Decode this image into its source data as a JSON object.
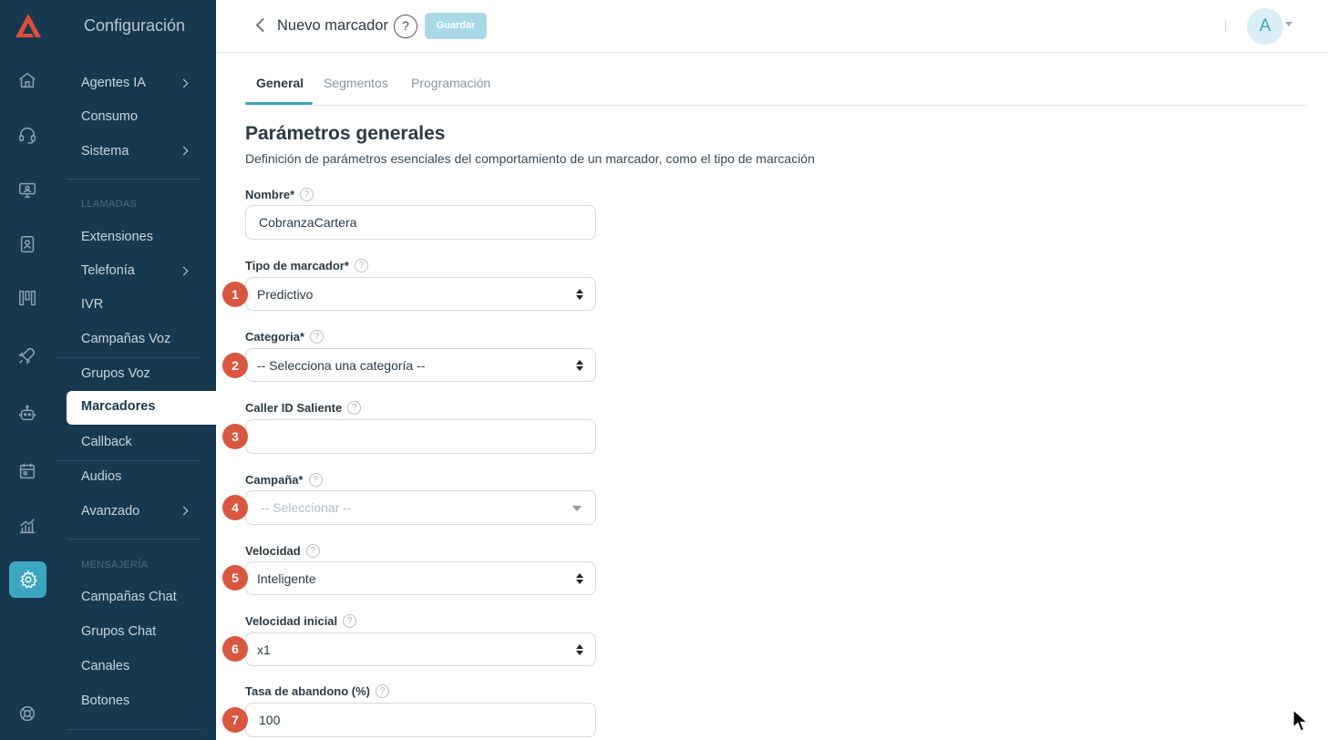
{
  "menu": {
    "title": "Configuración",
    "items": [
      {
        "label": "Agentes IA",
        "has_chevron": true
      },
      {
        "label": "Consumo"
      },
      {
        "label": "Sistema",
        "has_chevron": true
      }
    ],
    "section_calls": "LLAMADAS",
    "call_items": [
      {
        "label": "Extensiones"
      },
      {
        "label": "Telefonía",
        "has_chevron": true
      },
      {
        "label": "IVR"
      },
      {
        "label": "Campañas Voz"
      },
      {
        "label": "Grupos Voz"
      },
      {
        "label": "Marcadores",
        "active": true
      },
      {
        "label": "Callback"
      },
      {
        "label": "Audios"
      },
      {
        "label": "Avanzado",
        "has_chevron": true
      }
    ],
    "section_messaging": "MENSAJERÍA",
    "messaging_items": [
      {
        "label": "Campañas Chat"
      },
      {
        "label": "Grupos Chat"
      },
      {
        "label": "Canales"
      },
      {
        "label": "Botones"
      }
    ]
  },
  "rail": {
    "icons": [
      "home-icon",
      "headset-icon",
      "monitor-icon",
      "contacts-icon",
      "columns-icon",
      "rocket-icon",
      "robot-icon",
      "calendar-icon",
      "chart-icon",
      "gear-icon",
      "support-icon"
    ],
    "active": "gear-icon",
    "accent": "#3aa7bf",
    "background": "#17394f"
  },
  "header": {
    "title": "Nuevo marcador",
    "help": "?",
    "save_label": "Guardar",
    "avatar_initial": "A"
  },
  "tabs": [
    {
      "label": "General",
      "active": true
    },
    {
      "label": "Segmentos"
    },
    {
      "label": "Programación"
    }
  ],
  "page": {
    "title": "Parámetros generales",
    "description": "Definición de parámetros esenciales del comportamiento de un marcador, como el tipo de marcación"
  },
  "form": {
    "nombre": {
      "label": "Nombre*",
      "value": "CobranzaCartera"
    },
    "tipo": {
      "label": "Tipo de marcador*",
      "value": "Predictivo",
      "badge": "1"
    },
    "categoria": {
      "label": "Categoria*",
      "value": "-- Selecciona una categoría --",
      "badge": "2"
    },
    "caller_id": {
      "label": "Caller ID Saliente",
      "value": "",
      "badge": "3"
    },
    "campana": {
      "label": "Campaña*",
      "placeholder": "-- Seleccionar --",
      "badge": "4"
    },
    "velocidad": {
      "label": "Velocidad",
      "value": "Inteligente",
      "badge": "5"
    },
    "velocidad_inicial": {
      "label": "Velocidad inicial",
      "value": "x1",
      "badge": "6"
    },
    "tasa_abandono": {
      "label": "Tasa de abandono (%)",
      "value": "100",
      "badge": "7"
    }
  },
  "colors": {
    "badge": "#d9573f",
    "save_button": "#a9d9e6",
    "sidebar": "#17394f"
  }
}
